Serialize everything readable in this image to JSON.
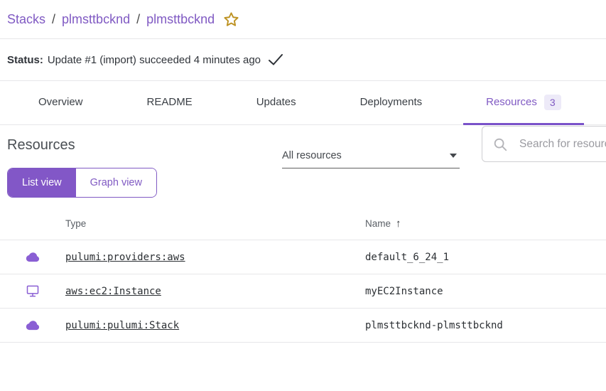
{
  "breadcrumb": {
    "items": [
      "Stacks",
      "plmsttbcknd",
      "plmsttbcknd"
    ],
    "separator": "/"
  },
  "status": {
    "label": "Status:",
    "text": "Update #1 (import) succeeded 4 minutes ago"
  },
  "tabs": [
    {
      "label": "Overview",
      "active": false
    },
    {
      "label": "README",
      "active": false
    },
    {
      "label": "Updates",
      "active": false
    },
    {
      "label": "Deployments",
      "active": false
    },
    {
      "label": "Resources",
      "active": true,
      "badge": "3"
    }
  ],
  "resources": {
    "heading": "Resources",
    "filter": {
      "selected": "All resources"
    },
    "search": {
      "placeholder": "Search for resources"
    },
    "view_toggle": {
      "list_label": "List view",
      "graph_label": "Graph view",
      "selected": "List view"
    }
  },
  "table": {
    "columns": {
      "type": "Type",
      "name": "Name",
      "name_sort": "asc",
      "sort_arrow": "↑"
    },
    "rows": [
      {
        "icon": "cloud-icon",
        "type": "pulumi:providers:aws",
        "name": "default_6_24_1"
      },
      {
        "icon": "monitor-icon",
        "type": "aws:ec2:Instance",
        "name": "myEC2Instance"
      },
      {
        "icon": "cloud-icon",
        "type": "pulumi:pulumi:Stack",
        "name": "plmsttbcknd-plmsttbcknd"
      }
    ]
  },
  "colors": {
    "accent_purple": "#805ac3",
    "toggle_fill_purple": "#8257c7",
    "star_gold": "#bd9222",
    "badge_bg": "#edeaf8",
    "divider": "#e7e7e9",
    "text_dark": "#2b2f33",
    "text_muted": "#5a5f66"
  }
}
